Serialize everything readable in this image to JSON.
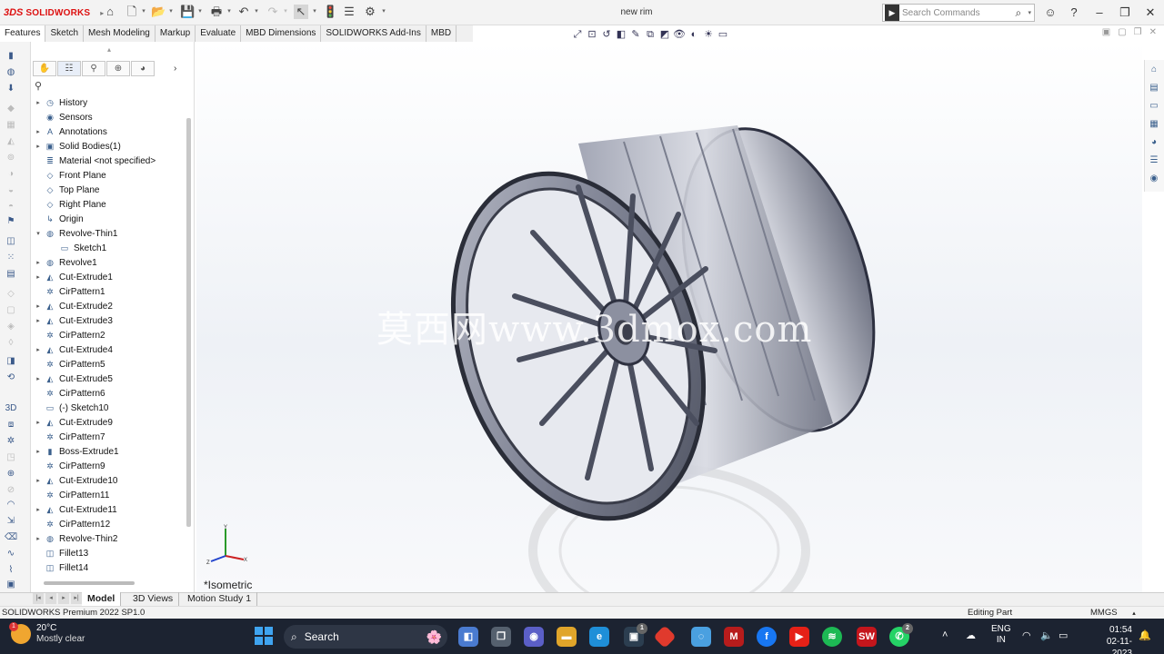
{
  "app": {
    "brand_ds": "3DS",
    "brand_name": "SOLIDWORKS",
    "doc_title": "new rim"
  },
  "search": {
    "placeholder": "Search Commands"
  },
  "command_tabs": [
    "Features",
    "Sketch",
    "Mesh Modeling",
    "Markup",
    "Evaluate",
    "MBD Dimensions",
    "SOLIDWORKS Add-Ins",
    "MBD"
  ],
  "active_command_tab": "Features",
  "feature_tree": [
    {
      "label": "History",
      "icon": "history-icon",
      "expandable": true
    },
    {
      "label": "Sensors",
      "icon": "sensor-icon",
      "expandable": false
    },
    {
      "label": "Annotations",
      "icon": "annotation-icon",
      "expandable": true
    },
    {
      "label": "Solid Bodies(1)",
      "icon": "solid-bodies-icon",
      "expandable": true
    },
    {
      "label": "Material <not specified>",
      "icon": "material-icon",
      "expandable": false
    },
    {
      "label": "Front Plane",
      "icon": "plane-icon",
      "expandable": false
    },
    {
      "label": "Top Plane",
      "icon": "plane-icon",
      "expandable": false
    },
    {
      "label": "Right Plane",
      "icon": "plane-icon",
      "expandable": false
    },
    {
      "label": "Origin",
      "icon": "origin-icon",
      "expandable": false
    },
    {
      "label": "Revolve-Thin1",
      "icon": "revolve-icon",
      "expandable": true,
      "expanded": true
    },
    {
      "label": "Sketch1",
      "icon": "sketch-icon",
      "expandable": false,
      "child": true
    },
    {
      "label": "Revolve1",
      "icon": "revolve-icon",
      "expandable": true
    },
    {
      "label": "Cut-Extrude1",
      "icon": "cut-extrude-icon",
      "expandable": true
    },
    {
      "label": "CirPattern1",
      "icon": "circular-pattern-icon",
      "expandable": false
    },
    {
      "label": "Cut-Extrude2",
      "icon": "cut-extrude-icon",
      "expandable": true
    },
    {
      "label": "Cut-Extrude3",
      "icon": "cut-extrude-icon",
      "expandable": true
    },
    {
      "label": "CirPattern2",
      "icon": "circular-pattern-icon",
      "expandable": false
    },
    {
      "label": "Cut-Extrude4",
      "icon": "cut-extrude-icon",
      "expandable": true
    },
    {
      "label": "CirPattern5",
      "icon": "circular-pattern-icon",
      "expandable": false
    },
    {
      "label": "Cut-Extrude5",
      "icon": "cut-extrude-icon",
      "expandable": true
    },
    {
      "label": "CirPattern6",
      "icon": "circular-pattern-icon",
      "expandable": false
    },
    {
      "label": "(-) Sketch10",
      "icon": "sketch-icon",
      "expandable": false
    },
    {
      "label": "Cut-Extrude9",
      "icon": "cut-extrude-icon",
      "expandable": true
    },
    {
      "label": "CirPattern7",
      "icon": "circular-pattern-icon",
      "expandable": false
    },
    {
      "label": "Boss-Extrude1",
      "icon": "boss-extrude-icon",
      "expandable": true
    },
    {
      "label": "CirPattern9",
      "icon": "circular-pattern-icon",
      "expandable": false
    },
    {
      "label": "Cut-Extrude10",
      "icon": "cut-extrude-icon",
      "expandable": true
    },
    {
      "label": "CirPattern11",
      "icon": "circular-pattern-icon",
      "expandable": false
    },
    {
      "label": "Cut-Extrude11",
      "icon": "cut-extrude-icon",
      "expandable": true
    },
    {
      "label": "CirPattern12",
      "icon": "circular-pattern-icon",
      "expandable": false
    },
    {
      "label": "Revolve-Thin2",
      "icon": "revolve-icon",
      "expandable": true
    },
    {
      "label": "Fillet13",
      "icon": "fillet-icon",
      "expandable": false
    },
    {
      "label": "Fillet14",
      "icon": "fillet-icon",
      "expandable": false
    }
  ],
  "graphics": {
    "watermark": "莫西网www.3dmox.com",
    "view_label": "*Isometric"
  },
  "bottom_tabs": [
    "Model",
    "3D Views",
    "Motion Study 1"
  ],
  "active_bottom_tab": "Model",
  "status": {
    "left": "SOLIDWORKS Premium 2022 SP1.0",
    "mode": "Editing Part",
    "units": "MMGS"
  },
  "taskbar": {
    "weather_temp": "20°C",
    "weather_desc": "Mostly clear",
    "weather_badge": "1",
    "search_label": "Search",
    "lang_top": "ENG",
    "lang_bottom": "IN",
    "time": "01:54",
    "date": "02-11-2023"
  },
  "colors": {
    "brand": "#d11111",
    "taskbar": "#1c2331",
    "accent": "#3fa4f0"
  }
}
